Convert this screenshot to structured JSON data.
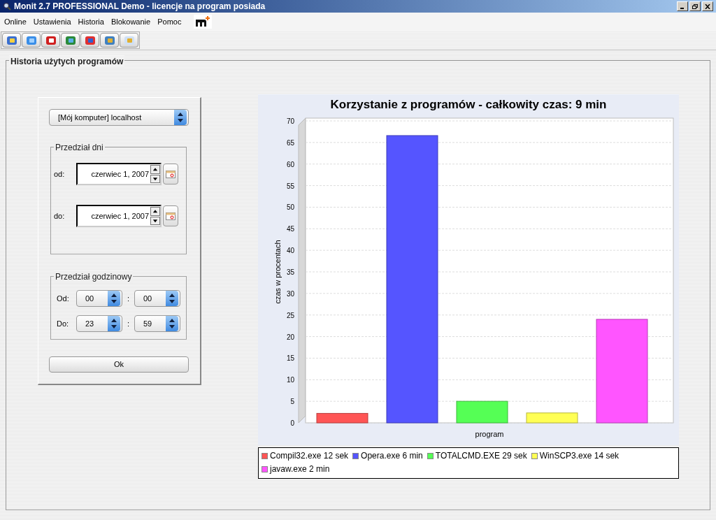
{
  "window": {
    "title": "Monit 2.7  PROFESSIONAL Demo - licencje na program posiada"
  },
  "menu": [
    "Online",
    "Ustawienia",
    "Historia",
    "Blokowanie",
    "Pomoc"
  ],
  "panel": {
    "title": "Historia użytych programów"
  },
  "computer_select": {
    "value": "[Mój komputer] localhost"
  },
  "day_range": {
    "title": "Przedział dni",
    "from_label": "od:",
    "from_value": "czerwiec 1, 2007",
    "to_label": "do:",
    "to_value": "czerwiec 1, 2007"
  },
  "hour_range": {
    "title": "Przedział godzinowy",
    "rows": [
      {
        "label": "Od:",
        "hour": "00",
        "separator": ":",
        "minute": "00"
      },
      {
        "label": "Do:",
        "hour": "23",
        "separator": ":",
        "minute": "59"
      }
    ]
  },
  "ok_button": "Ok",
  "chart": {
    "chart_data": {
      "type": "bar",
      "title": "Korzystanie z programów - całkowity czas: 9 min",
      "ylabel": "czas w procentach",
      "categories": [
        "program"
      ],
      "grid": true,
      "ylim": [
        0,
        70
      ],
      "yticks": [
        0,
        5,
        10,
        15,
        20,
        25,
        30,
        35,
        40,
        45,
        50,
        55,
        60,
        65,
        70
      ],
      "series": [
        {
          "name": "Compil32.exe 12 sek",
          "color": "#ff5555",
          "values": [
            2.2
          ]
        },
        {
          "name": "Opera.exe 6 min",
          "color": "#5555ff",
          "values": [
            66.6
          ]
        },
        {
          "name": "TOTALCMD.EXE 29 sek",
          "color": "#55ff55",
          "values": [
            5
          ]
        },
        {
          "name": "WinSCP3.exe 14 sek",
          "color": "#ffff55",
          "values": [
            2.3
          ]
        },
        {
          "name": "javaw.exe 2 min",
          "color": "#ff55ff",
          "values": [
            24
          ]
        }
      ]
    }
  }
}
